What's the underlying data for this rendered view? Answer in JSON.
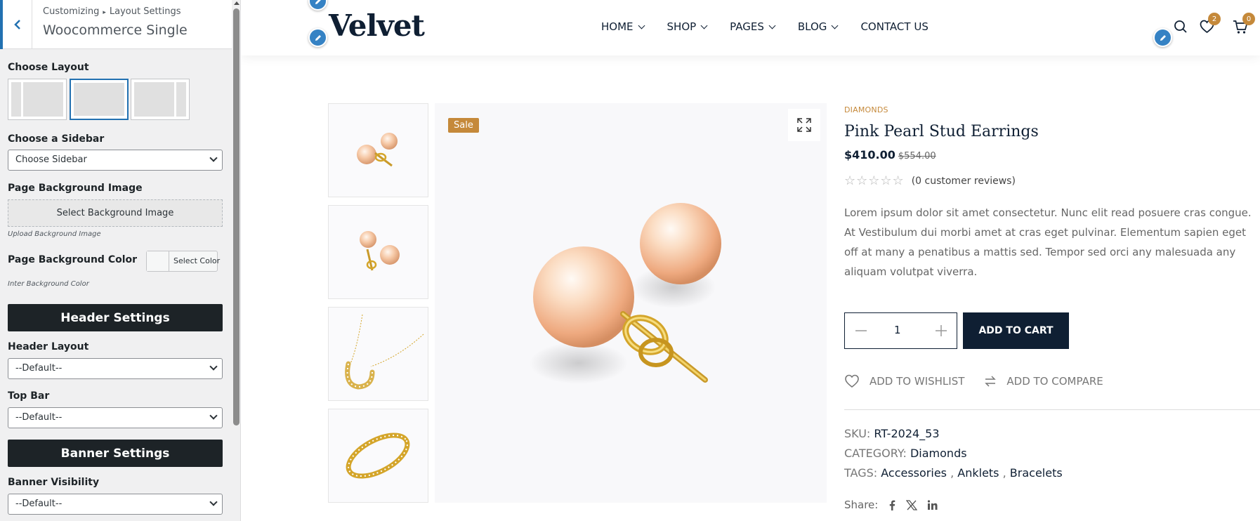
{
  "customizer": {
    "breadcrumb": [
      "Customizing",
      "Layout Settings"
    ],
    "section_title": "Woocommerce Single",
    "choose_layout_label": "Choose Layout",
    "layout_options": [
      "left-sidebar",
      "full-width",
      "right-sidebar"
    ],
    "selected_layout": "full-width",
    "choose_sidebar_label": "Choose a Sidebar",
    "choose_sidebar_value": "Choose Sidebar",
    "bg_image_label": "Page Background Image",
    "bg_image_button": "Select Background Image",
    "bg_image_hint": "Upload Background Image",
    "bg_color_label": "Page Background Color",
    "bg_color_button": "Select Color",
    "bg_color_hint": "Inter Background Color",
    "header_settings_title": "Header Settings",
    "header_layout_label": "Header Layout",
    "header_layout_value": "--Default--",
    "top_bar_label": "Top Bar",
    "top_bar_value": "--Default--",
    "banner_settings_title": "Banner Settings",
    "banner_visibility_label": "Banner Visibility",
    "banner_visibility_value": "--Default--"
  },
  "site": {
    "logo": "Velvet",
    "nav": [
      {
        "label": "HOME",
        "dropdown": true
      },
      {
        "label": "SHOP",
        "dropdown": true
      },
      {
        "label": "PAGES",
        "dropdown": true
      },
      {
        "label": "BLOG",
        "dropdown": true
      },
      {
        "label": "CONTACT US",
        "dropdown": false
      }
    ],
    "wishlist_count": "2",
    "cart_count": "0",
    "icons": [
      "search-icon",
      "heart-icon",
      "cart-icon",
      "pencil-icon"
    ]
  },
  "product": {
    "sale_badge": "Sale",
    "category": "DIAMONDS",
    "title": "Pink Pearl Stud Earrings",
    "price": "$410.00",
    "old_price": "$554.00",
    "rating_stars": 0,
    "reviews": "(0 customer reviews)",
    "description": "Lorem ipsum dolor sit amet consectetur. Nunc elit read posuere cras congue. At Vestibulum dui morbi amet at cras eget pulvinar. Elementum sapien eget off at many a penatibus a mattis sed. Tempor sed orci any malesuada any aliquam volutpat viverra.",
    "quantity": "1",
    "add_to_cart": "ADD TO CART",
    "add_to_wishlist": "ADD TO WISHLIST",
    "add_to_compare": "ADD TO COMPARE",
    "sku_label": "SKU:",
    "sku": "RT-2024_53",
    "category_label": "CATEGORY:",
    "category_value": "Diamonds",
    "tags_label": "TAGS:",
    "tags": [
      "Accessories",
      "Anklets",
      "Bracelets"
    ],
    "share_label": "Share:",
    "share_icons": [
      "facebook-icon",
      "x-icon",
      "linkedin-icon"
    ],
    "thumbnails": [
      "pearl-earrings",
      "pearl-earrings-alt",
      "diamond-necklace",
      "diamond-ring"
    ]
  },
  "colors": {
    "accent": "#c5893a",
    "navy": "#0f1f33",
    "wp_blue": "#2271b1",
    "section_bar": "#1d2327"
  }
}
